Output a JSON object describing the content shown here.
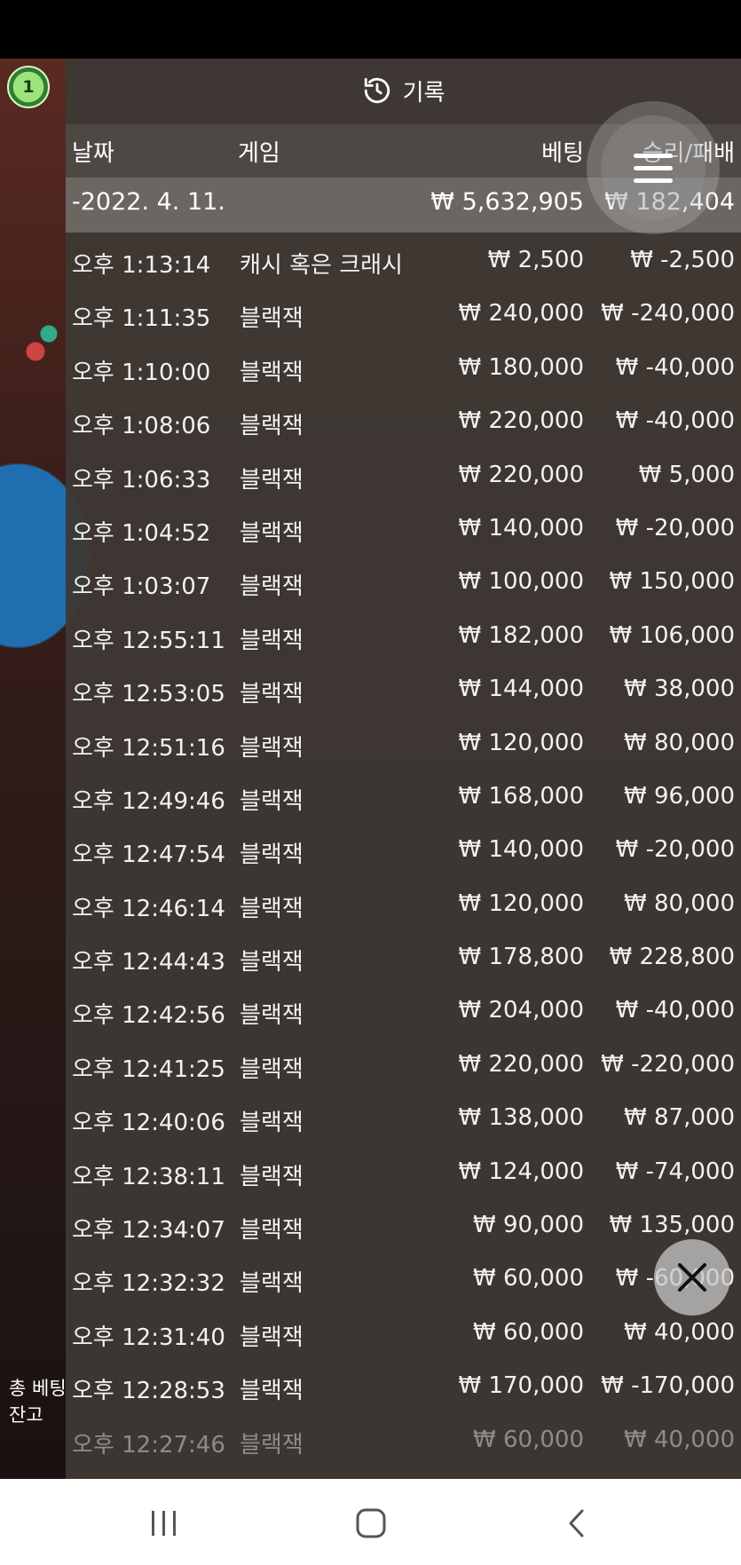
{
  "chip_count": "1",
  "header": {
    "title": "기록",
    "icon": "history-icon"
  },
  "columns": {
    "date": "날짜",
    "game": "게임",
    "bet": "베팅",
    "win_loss": "승리/패배"
  },
  "date_group": {
    "date": "-2022. 4. 11.",
    "total_bet": "₩ 5,632,905",
    "total_win_loss": "₩ 182,404"
  },
  "rows": [
    {
      "time": "오후 1:13:14",
      "game": "캐시 혹은 크래시",
      "bet": "₩ 2,500",
      "win_loss": "₩ -2,500"
    },
    {
      "time": "오후 1:11:35",
      "game": "블랙잭",
      "bet": "₩ 240,000",
      "win_loss": "₩ -240,000"
    },
    {
      "time": "오후 1:10:00",
      "game": "블랙잭",
      "bet": "₩ 180,000",
      "win_loss": "₩ -40,000"
    },
    {
      "time": "오후 1:08:06",
      "game": "블랙잭",
      "bet": "₩ 220,000",
      "win_loss": "₩ -40,000"
    },
    {
      "time": "오후 1:06:33",
      "game": "블랙잭",
      "bet": "₩ 220,000",
      "win_loss": "₩ 5,000"
    },
    {
      "time": "오후 1:04:52",
      "game": "블랙잭",
      "bet": "₩ 140,000",
      "win_loss": "₩ -20,000"
    },
    {
      "time": "오후 1:03:07",
      "game": "블랙잭",
      "bet": "₩ 100,000",
      "win_loss": "₩ 150,000"
    },
    {
      "time": "오후 12:55:11",
      "game": "블랙잭",
      "bet": "₩ 182,000",
      "win_loss": "₩ 106,000"
    },
    {
      "time": "오후 12:53:05",
      "game": "블랙잭",
      "bet": "₩ 144,000",
      "win_loss": "₩ 38,000"
    },
    {
      "time": "오후 12:51:16",
      "game": "블랙잭",
      "bet": "₩ 120,000",
      "win_loss": "₩ 80,000"
    },
    {
      "time": "오후 12:49:46",
      "game": "블랙잭",
      "bet": "₩ 168,000",
      "win_loss": "₩ 96,000"
    },
    {
      "time": "오후 12:47:54",
      "game": "블랙잭",
      "bet": "₩ 140,000",
      "win_loss": "₩ -20,000"
    },
    {
      "time": "오후 12:46:14",
      "game": "블랙잭",
      "bet": "₩ 120,000",
      "win_loss": "₩ 80,000"
    },
    {
      "time": "오후 12:44:43",
      "game": "블랙잭",
      "bet": "₩ 178,800",
      "win_loss": "₩ 228,800"
    },
    {
      "time": "오후 12:42:56",
      "game": "블랙잭",
      "bet": "₩ 204,000",
      "win_loss": "₩ -40,000"
    },
    {
      "time": "오후 12:41:25",
      "game": "블랙잭",
      "bet": "₩ 220,000",
      "win_loss": "₩ -220,000"
    },
    {
      "time": "오후 12:40:06",
      "game": "블랙잭",
      "bet": "₩ 138,000",
      "win_loss": "₩ 87,000"
    },
    {
      "time": "오후 12:38:11",
      "game": "블랙잭",
      "bet": "₩ 124,000",
      "win_loss": "₩ -74,000"
    },
    {
      "time": "오후 12:34:07",
      "game": "블랙잭",
      "bet": "₩ 90,000",
      "win_loss": "₩ 135,000"
    },
    {
      "time": "오후 12:32:32",
      "game": "블랙잭",
      "bet": "₩ 60,000",
      "win_loss": "₩ -60,000"
    },
    {
      "time": "오후 12:31:40",
      "game": "블랙잭",
      "bet": "₩ 60,000",
      "win_loss": "₩ 40,000"
    },
    {
      "time": "오후 12:28:53",
      "game": "블랙잭",
      "bet": "₩ 170,000",
      "win_loss": "₩ -170,000"
    },
    {
      "time": "오후 12:27:46",
      "game": "블랙잭",
      "bet": "₩ 60,000",
      "win_loss": "₩ 40,000"
    }
  ],
  "left_strip": {
    "total_bet_label": "총 베팅",
    "balance_label": "잔고"
  },
  "nav": {
    "recents_icon": "recents-icon",
    "home_icon": "home-icon",
    "back_icon": "back-icon"
  }
}
